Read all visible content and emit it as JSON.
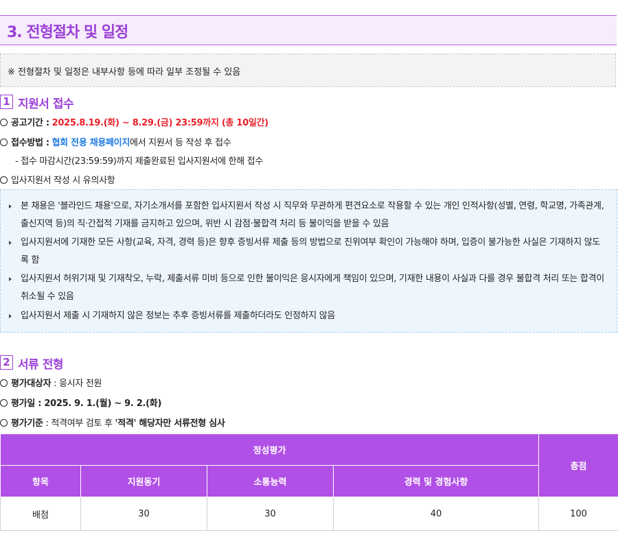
{
  "page_title": "3. 전형절차 및 일정",
  "notice": "※ 전형절차 및 일정은 내부사항 등에 따라 일부 조정될 수 있음",
  "section1": {
    "number": "1",
    "title": "지원서 접수",
    "period_label": "공고기간 :",
    "period_value": "2025.8.19.(화) ~ 8.29.(금) 23:59까지 (총 10일간)",
    "method_label": "접수방법 :",
    "method_link": "협회 전용 채용페이지",
    "method_rest": "에서 지원서 등 작성 후 접수",
    "method_sub": "-  접수 마감시간(23:59:59)까지 제출완료된 입사지원서에 한해 접수",
    "caution_label": "입사지원서 작성 시 유의사항",
    "caution_items": [
      "본 채용은 '블라인드 채용'으로, 자기소개서를 포함한 입사지원서 작성 시 직무와 무관하게 편견요소로 작용할 수 있는 개인 인적사항(성별, 연령, 학교명, 가족관계, 출신지역 등)의 직·간접적 기재를 금지하고 있으며, 위반 시 감점·불합격 처리 등 불이익을 받을 수 있음",
      "입사지원서에 기재한 모든 사항(교육, 자격, 경력 등)은 향후 증빙서류 제출 등의 방법으로 진위여부 확인이 가능해야 하며, 입증이 불가능한 사실은 기재하지 않도록 함",
      "입사지원서 허위기재 및 기재착오, 누락, 제출서류 미비 등으로 인한 불이익은 응시자에게 책임이 있으며, 기재한 내용이 사실과 다를 경우 불합격 처리 또는 합격이 취소될 수 있음",
      "입사지원서 제출 시 기재하지 않은 정보는 추후 증빙서류를 제출하더라도 인정하지 않음"
    ]
  },
  "section2": {
    "number": "2",
    "title": "서류 전형",
    "target_label": "평가대상자",
    "target_value": " : 응시자 전원",
    "date_label": "평가일 : 2025. 9. 1.(월) ~ 9. 2.(화)",
    "criteria_label": "평가기준",
    "criteria_value": " : 적격여부 검토 후 ",
    "criteria_bold": "'적격' 해당자만 서류전형 심사"
  },
  "table": {
    "group_header": "정성평가",
    "total_header": "총점",
    "columns": [
      "항목",
      "지원동기",
      "소통능력",
      "경력 및 경험사항"
    ],
    "row": [
      "배점",
      "30",
      "30",
      "40",
      "100"
    ]
  },
  "colors": {
    "accent_purple": "#9b3fd8",
    "table_header": "#b150e6",
    "red": "#e8202a",
    "blue": "#1e7be0"
  }
}
